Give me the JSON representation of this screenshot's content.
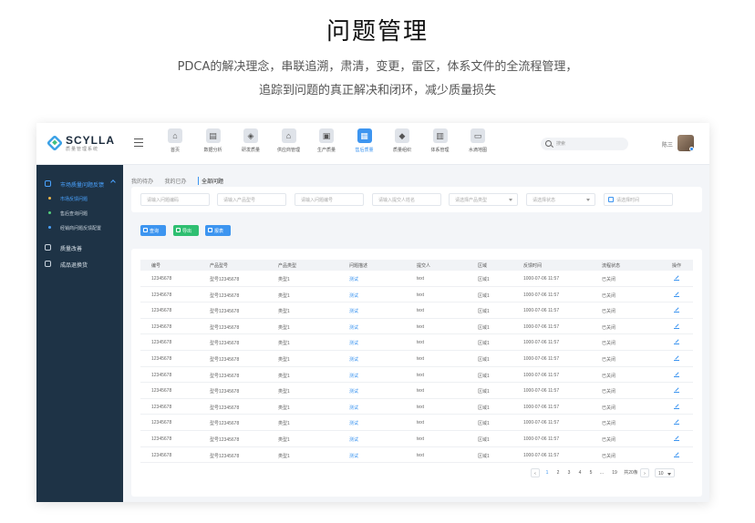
{
  "hero": {
    "title": "问题管理",
    "line1": "PDCA的解决理念，串联追溯，肃清，变更，雷区，体系文件的全流程管理，",
    "line2": "追踪到问题的真正解决和闭环，减少质量损失"
  },
  "logo": {
    "name": "SCYLLA",
    "subtitle": "质量管理系统"
  },
  "nav": [
    {
      "label": "首页",
      "icon": "home-icon",
      "glyph": "⌂",
      "active": false
    },
    {
      "label": "数据分析",
      "icon": "chart-icon",
      "glyph": "▤",
      "active": false
    },
    {
      "label": "研发质量",
      "icon": "cube-icon",
      "glyph": "◈",
      "active": false
    },
    {
      "label": "供应商管理",
      "icon": "store-icon",
      "glyph": "⌂",
      "active": false
    },
    {
      "label": "生产质量",
      "icon": "device-icon",
      "glyph": "▣",
      "active": false
    },
    {
      "label": "售后质量",
      "icon": "service-icon",
      "glyph": "▦",
      "active": true
    },
    {
      "label": "质量组织",
      "icon": "shield-icon",
      "glyph": "◆",
      "active": false
    },
    {
      "label": "体系管理",
      "icon": "folder-icon",
      "glyph": "▥",
      "active": false
    },
    {
      "label": "水滴地图",
      "icon": "chat-icon",
      "glyph": "▭",
      "active": false
    }
  ],
  "search": {
    "placeholder": "搜索"
  },
  "user": {
    "name": "陈三"
  },
  "sidebar": {
    "groups": [
      {
        "label": "市场质量问题反馈",
        "active": true
      },
      {
        "label": "质量改善",
        "active": false
      },
      {
        "label": "成品退换货",
        "active": false
      }
    ],
    "subitems": [
      {
        "label": "市场反馈问题",
        "active": true
      },
      {
        "label": "售后查询问题",
        "active": false
      },
      {
        "label": "经销商问题反馈配置",
        "active": false
      }
    ]
  },
  "tabs": [
    {
      "label": "我的待办",
      "active": false
    },
    {
      "label": "我的已办",
      "active": false
    },
    {
      "label": "全部问题",
      "active": true
    }
  ],
  "filters": [
    {
      "placeholder": "请输入问题编码",
      "type": "text"
    },
    {
      "placeholder": "请输入产品型号",
      "type": "text"
    },
    {
      "placeholder": "请输入问题编号",
      "type": "text"
    },
    {
      "placeholder": "请输入提交人姓名",
      "type": "text"
    },
    {
      "placeholder": "请选择产品类型",
      "type": "select"
    },
    {
      "placeholder": "请选择状态",
      "type": "select"
    },
    {
      "placeholder": "请选择时间",
      "type": "date"
    }
  ],
  "actions": {
    "query": "查询",
    "export": "导出",
    "report": "报表"
  },
  "table": {
    "columns": [
      "编号",
      "产品型号",
      "产品类型",
      "问题描述",
      "提交人",
      "区域",
      "反馈时间",
      "流程状态",
      "操作"
    ],
    "rows": [
      [
        "12345678",
        "型号12345678",
        "类型1",
        "测试",
        "text",
        "区域1",
        "1000-07-06 11:57",
        "已关闭"
      ],
      [
        "12345678",
        "型号12345678",
        "类型1",
        "测试",
        "text",
        "区域1",
        "1000-07-06 11:57",
        "已关闭"
      ],
      [
        "12345678",
        "型号12345678",
        "类型1",
        "测试",
        "text",
        "区域1",
        "1000-07-06 11:57",
        "已关闭"
      ],
      [
        "12345678",
        "型号12345678",
        "类型1",
        "测试",
        "text",
        "区域1",
        "1000-07-06 11:57",
        "已关闭"
      ],
      [
        "12345678",
        "型号12345678",
        "类型1",
        "测试",
        "text",
        "区域1",
        "1000-07-06 11:57",
        "已关闭"
      ],
      [
        "12345678",
        "型号12345678",
        "类型1",
        "测试",
        "text",
        "区域1",
        "1000-07-06 11:57",
        "已关闭"
      ],
      [
        "12345678",
        "型号12345678",
        "类型1",
        "测试",
        "text",
        "区域1",
        "1000-07-06 11:57",
        "已关闭"
      ],
      [
        "12345678",
        "型号12345678",
        "类型1",
        "测试",
        "text",
        "区域1",
        "1000-07-06 11:57",
        "已关闭"
      ],
      [
        "12345678",
        "型号12345678",
        "类型1",
        "测试",
        "text",
        "区域1",
        "1000-07-06 11:57",
        "已关闭"
      ],
      [
        "12345678",
        "型号12345678",
        "类型1",
        "测试",
        "text",
        "区域1",
        "1000-07-06 11:57",
        "已关闭"
      ],
      [
        "12345678",
        "型号12345678",
        "类型1",
        "测试",
        "text",
        "区域1",
        "1000-07-06 11:57",
        "已关闭"
      ],
      [
        "12345678",
        "型号12345678",
        "类型1",
        "测试",
        "text",
        "区域1",
        "1000-07-06 11:57",
        "已关闭"
      ]
    ]
  },
  "pagination": {
    "prev": "‹",
    "pages": [
      "1",
      "2",
      "3",
      "4",
      "5"
    ],
    "active_page": "1",
    "ellipsis": "...",
    "last_page": "19",
    "total": "共20条",
    "next": "›",
    "page_size": "10"
  },
  "colors": {
    "accent": "#3d95f0",
    "success": "#2fbf71",
    "sidebar": "#1e3346"
  }
}
